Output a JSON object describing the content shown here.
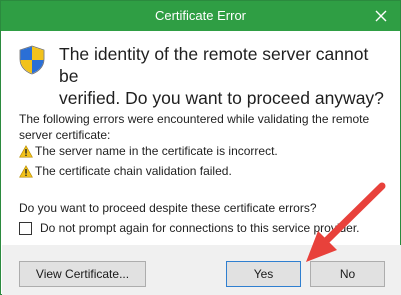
{
  "window": {
    "title": "Certificate Error",
    "accent": "#2f9e44"
  },
  "header": {
    "line1": "The identity of the remote server cannot be",
    "line2": "verified. Do you want to proceed anyway?"
  },
  "errors": {
    "intro_line1": "The following errors were encountered while validating the remote",
    "intro_line2": "server certificate:",
    "items": [
      "The server name in the certificate is incorrect.",
      "The certificate chain validation failed."
    ]
  },
  "question": "Do you want to proceed despite these certificate errors?",
  "checkbox": {
    "label": "Do not prompt again for connections to this service provider.",
    "checked": false
  },
  "buttons": {
    "view": "View Certificate...",
    "yes": "Yes",
    "no": "No"
  },
  "annotation": {
    "color": "#e8413b",
    "icon": "arrow-pointing-to-yes-button"
  }
}
